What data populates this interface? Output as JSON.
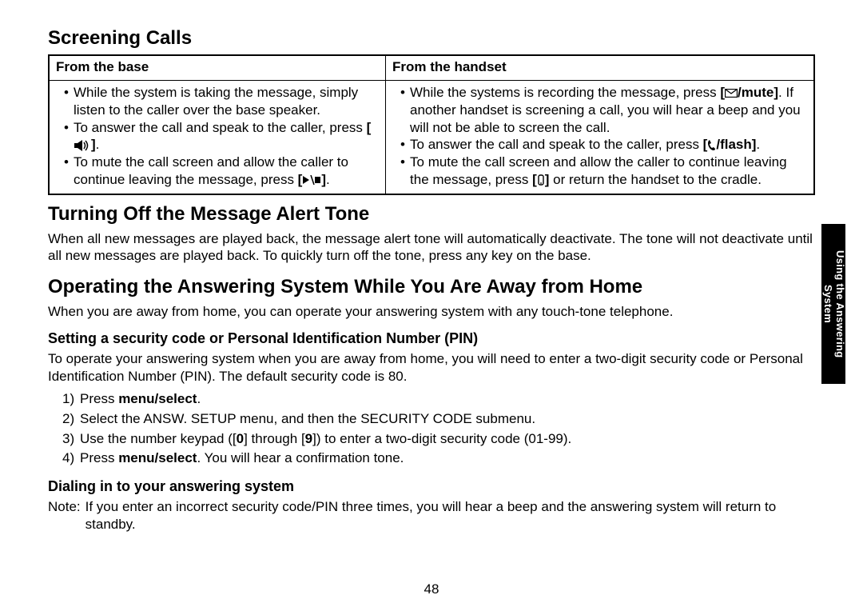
{
  "section_tab": "Using the Answering\nSystem",
  "page_number": "48",
  "headings": {
    "screening": "Screening Calls",
    "alert_tone": "Turning Off the Message Alert Tone",
    "operating_away": "Operating the Answering System While You Are Away from Home",
    "setting_pin": "Setting a security code or Personal Identification Number (PIN)",
    "dialing_in": "Dialing in to your answering system"
  },
  "table": {
    "headers": {
      "col1": "From the base",
      "col2": "From the handset"
    },
    "base": {
      "b1": "While the system is taking the message, simply listen to the caller over the base speaker.",
      "b2_pre": "To answer the call and speak to the caller, press ",
      "b2_key_name": "speaker-icon",
      "b2_post": ".",
      "b3_pre": "To mute the call screen and allow the caller to continue leaving the message, press ",
      "b3_key_name": "play-stop-icon",
      "b3_post": "."
    },
    "handset": {
      "h1_pre": "While the systems is recording the message, press ",
      "h1_key_name": "mail-mute-icon",
      "h1_key_text": "/mute",
      "h1_post": ". If another handset is screening a call, you will hear a beep and you will not be able to screen the call.",
      "h2_pre": "To answer the call and speak to the caller, press ",
      "h2_key_name": "talk-flash-icon",
      "h2_key_text": "/flash",
      "h2_post": ".",
      "h3_pre": "To mute the call screen and allow the caller to continue leaving the message, press ",
      "h3_key_name": "end-icon",
      "h3_post": " or return the handset to the cradle."
    }
  },
  "alert_tone_text": "When all new messages are played back, the message alert tone will automatically deactivate. The tone will not deactivate until all new messages are played back. To quickly turn off the tone, press any key on the base.",
  "operating_away_text": "When you are away from home, you can operate your answering system with any touch-tone telephone.",
  "setting_pin_text": "To operate your answering system when you are away from home, you will need to enter a two-digit security code or Personal Identification Number (PIN). The default security code is 80.",
  "steps": {
    "s1_pre": "Press ",
    "s1_bold": "menu/select",
    "s1_post": ".",
    "s2": "Select the ANSW. SETUP menu, and then the SECURITY CODE submenu.",
    "s3_pre": "Use the number keypad (",
    "s3_b1": "0",
    "s3_mid": " through ",
    "s3_b2": "9",
    "s3_post": ") to enter a two-digit security code (01-99).",
    "s4_pre": "Press ",
    "s4_bold": "menu/select",
    "s4_post": ". You will hear a confirmation tone."
  },
  "note": {
    "label": "Note:",
    "text": "If you enter an incorrect security code/PIN three times, you will hear a beep and the answering system will return to standby."
  }
}
